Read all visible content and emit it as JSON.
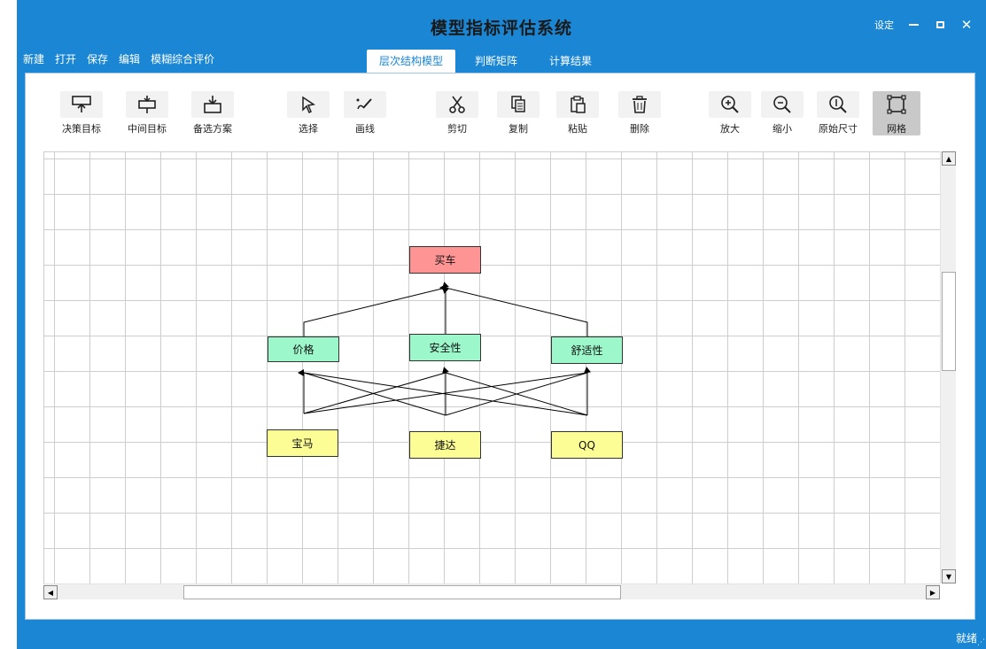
{
  "window": {
    "title": "模型指标评估系统"
  },
  "title_controls": {
    "settings": "设定",
    "minimize_icon": "minimize-icon",
    "maximize_icon": "maximize-icon",
    "close_icon": "close-icon"
  },
  "menu": [
    "新建",
    "打开",
    "保存",
    "编辑",
    "模糊综合评价"
  ],
  "tabs": [
    {
      "label": "层次结构模型",
      "active": true
    },
    {
      "label": "判断矩阵",
      "active": false
    },
    {
      "label": "计算结果",
      "active": false
    }
  ],
  "toolbar": [
    {
      "label": "决策目标",
      "icon": "decision-goal-icon"
    },
    {
      "label": "中间目标",
      "icon": "intermediate-goal-icon"
    },
    {
      "label": "备选方案",
      "icon": "alternative-icon"
    },
    {
      "label": "选择",
      "icon": "select-cursor-icon"
    },
    {
      "label": "画线",
      "icon": "draw-line-icon"
    },
    {
      "label": "剪切",
      "icon": "scissors-icon"
    },
    {
      "label": "复制",
      "icon": "copy-icon"
    },
    {
      "label": "粘贴",
      "icon": "paste-icon"
    },
    {
      "label": "删除",
      "icon": "trash-icon"
    },
    {
      "label": "放大",
      "icon": "zoom-in-icon"
    },
    {
      "label": "缩小",
      "icon": "zoom-out-icon"
    },
    {
      "label": "原始尺寸",
      "icon": "actual-size-icon"
    },
    {
      "label": "网格",
      "icon": "grid-icon",
      "active": true
    }
  ],
  "diagram": {
    "goal": "买车",
    "criteria": [
      "价格",
      "安全性",
      "舒适性"
    ],
    "alternatives": [
      "宝马",
      "捷达",
      "QQ"
    ]
  },
  "status": {
    "text": "就绪"
  },
  "colors": {
    "chrome": "#1a86d4",
    "goal_node": "#ff9494",
    "criteria_node": "#9cf7cb",
    "alternative_node": "#fdfd95",
    "active_tab_text": "#1a86d4"
  }
}
